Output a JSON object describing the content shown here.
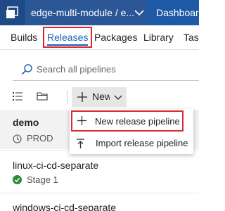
{
  "header": {
    "project": "edge-multi-module / e...",
    "dashboards_label": "Dashboard"
  },
  "tabs": [
    {
      "label": "Builds"
    },
    {
      "label": "Releases",
      "active": true
    },
    {
      "label": "Packages"
    },
    {
      "label": "Library"
    },
    {
      "label": "Task"
    }
  ],
  "search": {
    "placeholder": "Search all pipelines"
  },
  "toolbar": {
    "new_label": "New"
  },
  "new_menu": {
    "items": [
      {
        "label": "New release pipeline",
        "icon": "plus-icon"
      },
      {
        "label": "Import release pipeline",
        "icon": "import-icon"
      }
    ]
  },
  "pipelines": [
    {
      "name": "demo",
      "status_label": "PROD",
      "status_icon": "clock-icon"
    },
    {
      "name": "linux-ci-cd-separate",
      "status_label": "Stage 1",
      "status_icon": "success-check-icon"
    },
    {
      "name": "windows-ci-cd-separate"
    }
  ],
  "colors": {
    "top_bar": "#2b5797",
    "accent": "#1b5fb8",
    "highlight_box": "#d9282f",
    "success": "#2e8b3d"
  }
}
